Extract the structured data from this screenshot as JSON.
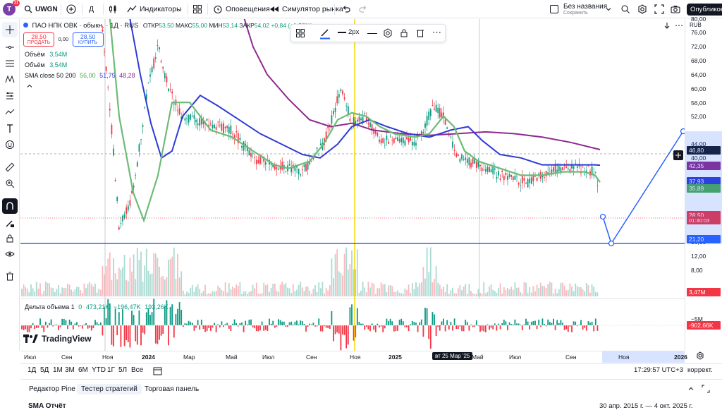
{
  "topbar": {
    "avatar_badge": "11",
    "avatar_letter": "T",
    "symbol": "UWGN",
    "interval": "Д",
    "indicators_label": "Индикаторы",
    "alerts_label": "Оповещения",
    "replay_label": "Симулятор рынка",
    "layout_name": "Без названия",
    "layout_status": "Сохранить",
    "publish_label": "Опубликовать"
  },
  "legend": {
    "title": "ПАО НПК ОВК · обыкн. · 1Д · RUS",
    "open_label": "ОТКР",
    "open": "53,50",
    "high_label": "МАКС",
    "high": "55,00",
    "low_label": "МИН",
    "low": "53,14",
    "close_label": "ЗАКР",
    "close": "54,02",
    "change": "+0,84 (+1,58%)",
    "sell_price": "28,50",
    "sell_label": "ПРОДАТЬ",
    "spread": "0,00",
    "buy_price": "28,50",
    "buy_label": "КУПИТЬ",
    "vol1_label": "Объём",
    "vol1": "3,54M",
    "vol2_label": "Объём",
    "vol2": "3,54M",
    "sma_label": "SMA close 50 200",
    "sma1": "56,00",
    "sma2": "51,75",
    "sma3": "48,28",
    "delta_label": "Дельта объема 1",
    "delta1": "0",
    "delta2": "473,21K",
    "delta3": "−196,47K",
    "delta4": "193,26K"
  },
  "draw_toolbar": {
    "width_label": "2px"
  },
  "price_scale": {
    "currency": "RUB",
    "ticks": [
      "80,00",
      "76,00",
      "72,00",
      "68,00",
      "64,00",
      "60,00",
      "56,00",
      "52,00",
      "44,00",
      "40,00",
      "32,00",
      "24,00",
      "16,00",
      "12,00",
      "8,00"
    ],
    "tags": [
      {
        "value": "46,80",
        "color": "#131722"
      },
      {
        "value": "42,35",
        "color": "#8e2a8e"
      },
      {
        "value": "37,93",
        "color": "#2f3bd6"
      },
      {
        "value": "35,89",
        "color": "#4caf50"
      },
      {
        "value": "28,50",
        "color": "#f23645"
      },
      {
        "value": "01:30:03",
        "color": "#f23645"
      },
      {
        "value": "21,20",
        "color": "#2962ff"
      },
      {
        "value": "3,47M",
        "color": "#f23645"
      },
      {
        "value": "-902,66K",
        "color": "#f23645"
      }
    ],
    "delta_ticks": [
      "5M",
      "−5M"
    ]
  },
  "time_axis": {
    "labels": [
      "Июл",
      "Сен",
      "Ноя",
      "2024",
      "Мар",
      "Май",
      "Июл",
      "Сен",
      "Ноя",
      "2025",
      "Май",
      "Июл",
      "Сен",
      "Ноя",
      "2026"
    ],
    "crosshair_label": "вт 25 Мар '25"
  },
  "bottom_bar": {
    "periods": [
      "1Д",
      "5Д",
      "1М",
      "3М",
      "6М",
      "YTD",
      "1Г",
      "5Л",
      "Все"
    ],
    "clock": "17:29:57 UTC+3",
    "adjust_label": "коррект."
  },
  "bottom_tabs": {
    "tabs": [
      "Редактор Pine",
      "Тестер стратегий",
      "Торговая панель"
    ],
    "strategy_name": "SMA Отчёт",
    "date_range": "30 апр. 2015 г. — 4 окт. 2025 г."
  },
  "brand": {
    "logo_text": "TradingView"
  },
  "colors": {
    "up": "#089981",
    "down": "#f23645",
    "sma_fast": "#4caf50",
    "sma_mid": "#2f3bd6",
    "sma_slow": "#8e2a8e",
    "drawing": "#2962ff",
    "crosshair": "#f5d800"
  }
}
